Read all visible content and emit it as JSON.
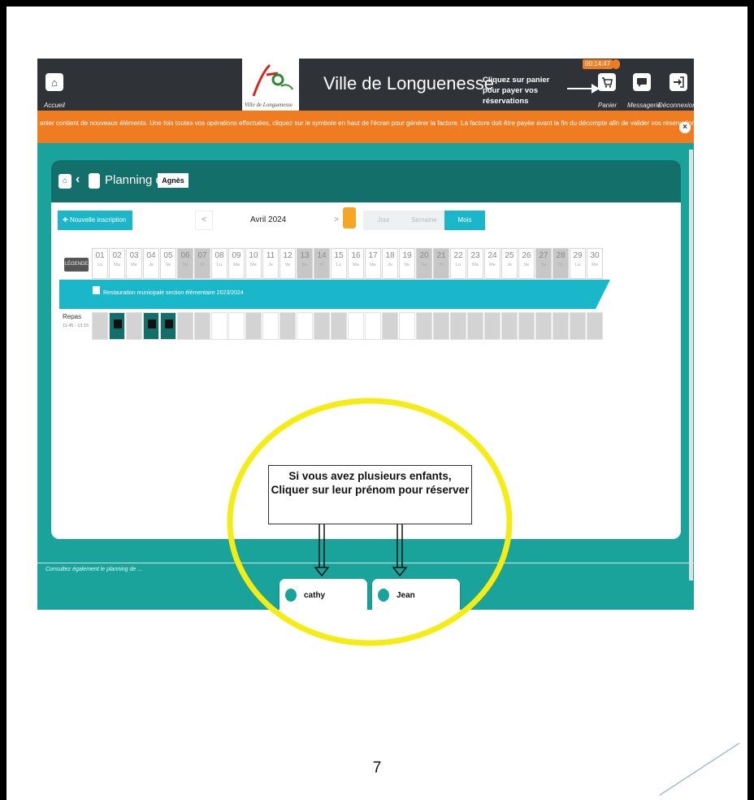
{
  "header": {
    "home_label": "Accueil",
    "site_title": "Ville de Longuenesse",
    "logo_text": "Ville de Longuenesse",
    "pay_hint": "Cliquez sur panier pour payer vos réservations",
    "timer": "00:14:47",
    "cart_label": "Panier",
    "messages_label": "Messagerie",
    "logout_label": "Déconnexion"
  },
  "notification": {
    "text": "anier contient de nouveaux éléments. Une fois toutes vos opérations effectuées, cliquez sur le symbole  en haut de l'écran pour générer la facture. La facture doit être payée avant la fin du décompte afin de valider vos réservations.",
    "close": "×"
  },
  "planning": {
    "title": "Planning de",
    "child": "Agnès",
    "new_label": "Nouvelle inscription",
    "prev": "<",
    "next": ">",
    "month": "Avril 2024",
    "views": [
      "Jour",
      "Semaine",
      "Mois"
    ],
    "legend_label": "LÉGENDE",
    "days": [
      {
        "n": "01",
        "w": "Lu"
      },
      {
        "n": "02",
        "w": "Ma"
      },
      {
        "n": "03",
        "w": "Me"
      },
      {
        "n": "04",
        "w": "Je"
      },
      {
        "n": "05",
        "w": "Ve"
      },
      {
        "n": "06",
        "w": "Sa"
      },
      {
        "n": "07",
        "w": "Di"
      },
      {
        "n": "08",
        "w": "Lu"
      },
      {
        "n": "09",
        "w": "Ma"
      },
      {
        "n": "10",
        "w": "Me"
      },
      {
        "n": "11",
        "w": "Je"
      },
      {
        "n": "12",
        "w": "Ve"
      },
      {
        "n": "13",
        "w": "Sa"
      },
      {
        "n": "14",
        "w": "Di"
      },
      {
        "n": "15",
        "w": "Lu"
      },
      {
        "n": "16",
        "w": "Ma"
      },
      {
        "n": "17",
        "w": "Me"
      },
      {
        "n": "18",
        "w": "Je"
      },
      {
        "n": "19",
        "w": "Ve"
      },
      {
        "n": "20",
        "w": "Sa"
      },
      {
        "n": "21",
        "w": "Di"
      },
      {
        "n": "22",
        "w": "Lu"
      },
      {
        "n": "23",
        "w": "Ma"
      },
      {
        "n": "24",
        "w": "Me"
      },
      {
        "n": "25",
        "w": "Je"
      },
      {
        "n": "26",
        "w": "Ve"
      },
      {
        "n": "27",
        "w": "Sa"
      },
      {
        "n": "28",
        "w": "Di"
      },
      {
        "n": "29",
        "w": "Lu"
      },
      {
        "n": "30",
        "w": "Ma"
      }
    ],
    "service": "Restauration municipale section élémentaire 2023/2024",
    "row_label": "Repas",
    "row_time": "11:45 - 13:15",
    "slot_states": [
      "locked",
      "booked",
      "locked",
      "booked",
      "booked",
      "locked",
      "locked",
      "open",
      "open",
      "locked",
      "open",
      "locked",
      "open",
      "locked",
      "locked",
      "open",
      "open",
      "locked",
      "open",
      "locked",
      "locked",
      "locked",
      "locked",
      "locked",
      "locked",
      "locked",
      "locked",
      "locked",
      "locked",
      "locked"
    ]
  },
  "footer": {
    "note": "Consultez également le planning de ...",
    "children": [
      {
        "name": "cathy"
      },
      {
        "name": "Jean"
      }
    ]
  },
  "annotation": {
    "text": "Si vous avez plusieurs enfants, Cliquer sur leur prénom pour réserver",
    "highlight_color": "#f4ec12"
  },
  "page_number": "7",
  "colors": {
    "topbar": "#2f3337",
    "accent_orange": "#f07c22",
    "teal": "#1aa39b",
    "teal_dark": "#136f69",
    "cyan": "#1ab6c9"
  }
}
